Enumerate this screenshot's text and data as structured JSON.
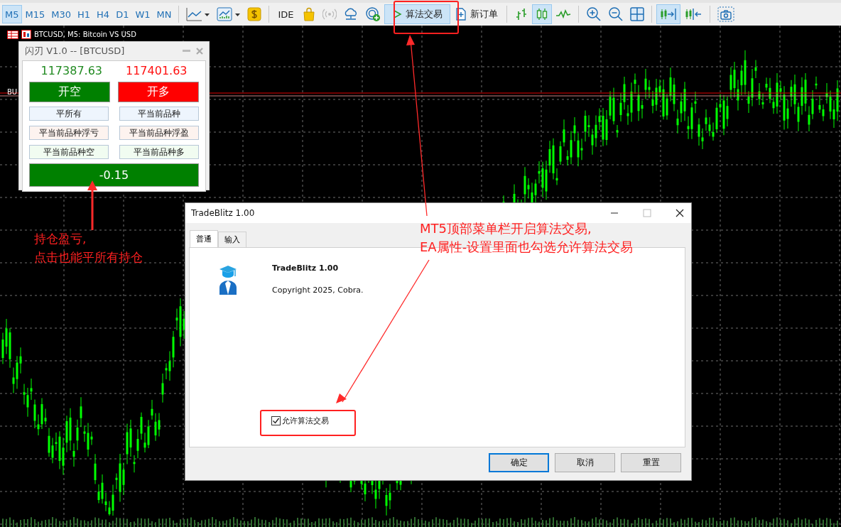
{
  "toolbar": {
    "timeframes": [
      {
        "label": "M5",
        "selected": true
      },
      {
        "label": "M15",
        "selected": false
      },
      {
        "label": "M30",
        "selected": false
      },
      {
        "label": "H1",
        "selected": false
      },
      {
        "label": "H4",
        "selected": false
      },
      {
        "label": "D1",
        "selected": false
      },
      {
        "label": "W1",
        "selected": false
      },
      {
        "label": "MN",
        "selected": false
      }
    ],
    "tools": [
      {
        "kind": "separator"
      },
      {
        "kind": "line-chart",
        "selected": false
      },
      {
        "kind": "indicators",
        "selected": false
      },
      {
        "kind": "dollar",
        "selected": false
      },
      {
        "kind": "separator"
      },
      {
        "kind": "text",
        "label": "IDE",
        "selected": false
      },
      {
        "kind": "bag",
        "selected": false
      },
      {
        "kind": "signal",
        "selected": false
      },
      {
        "kind": "cloud",
        "selected": false
      },
      {
        "kind": "target",
        "selected": false
      },
      {
        "kind": "algo",
        "label": "算法交易",
        "selected": true
      },
      {
        "kind": "new-order",
        "label": "新订单",
        "selected": false
      },
      {
        "kind": "separator"
      },
      {
        "kind": "bars",
        "selected": false
      },
      {
        "kind": "candles",
        "selected": true
      },
      {
        "kind": "line",
        "selected": false
      },
      {
        "kind": "separator"
      },
      {
        "kind": "zoom-in",
        "selected": false
      },
      {
        "kind": "zoom-out",
        "selected": false
      },
      {
        "kind": "grid",
        "selected": false
      },
      {
        "kind": "separator"
      },
      {
        "kind": "shift",
        "selected": true
      },
      {
        "kind": "autoscroll",
        "selected": false
      },
      {
        "kind": "separator"
      },
      {
        "kind": "screenshot",
        "selected": false
      }
    ]
  },
  "chart": {
    "title": "BTCUSD, M5:  Bitcoin VS USD",
    "line_label": "BU"
  },
  "panel": {
    "title": "闪刃 V1.0 -- [BTCUSD]",
    "bid": "117387.63",
    "ask": "117401.63",
    "trade_buttons": [
      {
        "label": "开空",
        "color": "#008000"
      },
      {
        "label": "开多",
        "color": "#ff0000"
      }
    ],
    "close_buttons": [
      {
        "label": "平所有",
        "color": "#eef5fd"
      },
      {
        "label": "平当前品种",
        "color": "#eef5fd"
      },
      {
        "label": "平当前品种浮亏",
        "color": "#fdf3ef"
      },
      {
        "label": "平当前品种浮盈",
        "color": "#fdf3ef"
      },
      {
        "label": "平当前品种空",
        "color": "#f1fcf1"
      },
      {
        "label": "平当前品种多",
        "color": "#f1fcf1"
      }
    ],
    "profit": "-0.15"
  },
  "dialog": {
    "title": "TradeBlitz 1.00",
    "tabs": [
      {
        "label": "普通",
        "selected": true
      },
      {
        "label": "输入",
        "selected": false
      }
    ],
    "name": "TradeBlitz 1.00",
    "copyright": "Copyright 2025, Cobra.",
    "checkbox": {
      "label": "允许算法交易",
      "checked": true
    },
    "buttons": [
      "确定",
      "取消",
      "重置"
    ]
  },
  "annotations": [
    {
      "lines": [
        "持仓盈亏,",
        "点击也能平所有持仓"
      ]
    },
    {
      "lines": [
        "MT5顶部菜单栏开启算法交易,",
        "EA属性-设置里面也勾选允许算法交易"
      ]
    }
  ]
}
